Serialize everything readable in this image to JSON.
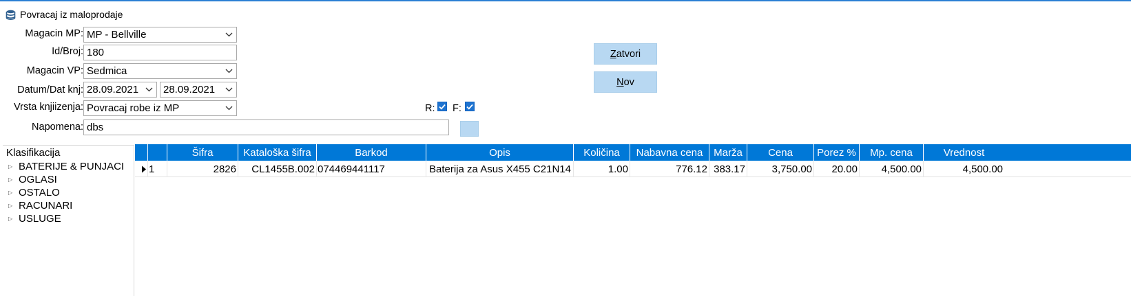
{
  "window": {
    "title": "Povracaj iz maloprodaje",
    "icon": "database-icon"
  },
  "form": {
    "magacin_mp": {
      "label": "Magacin MP:",
      "value": "MP - Bellville"
    },
    "id_broj": {
      "label": "Id/Broj:",
      "value": "180"
    },
    "magacin_vp": {
      "label": "Magacin VP:",
      "value": "Sedmica"
    },
    "datum": {
      "label": "Datum/Dat knj:",
      "date": "28.09.2021",
      "date_knj": "28.09.2021"
    },
    "vrsta": {
      "label": "Vrsta knjiizenja:",
      "value": "Povracaj robe iz MP"
    },
    "napomena": {
      "label": "Napomena:",
      "value": "dbs"
    },
    "r_label": "R:",
    "f_label": "F:",
    "r_checked": true,
    "f_checked": true
  },
  "buttons": {
    "zatvori": {
      "mnemonic": "Z",
      "rest": "atvori"
    },
    "nov": {
      "mnemonic": "N",
      "rest": "ov"
    }
  },
  "tree": {
    "header": "Klasifikacija",
    "items": [
      "BATERIJE & PUNJACI",
      "OGLASI",
      "OSTALO",
      "RACUNARI",
      "USLUGE"
    ]
  },
  "grid": {
    "columns": [
      "",
      "",
      "Šifra",
      "Kataloška šifra",
      "Barkod",
      "Opis",
      "Količina",
      "Nabavna cena",
      "Marža",
      "Cena",
      "Porez %",
      "Mp. cena",
      "Vrednost"
    ],
    "rows": [
      {
        "rb": "1",
        "sifra": "2826",
        "kataloska": "CL1455B.002",
        "barkod": "074469441117",
        "opis": "Baterija za Asus X455  C21N14",
        "kolicina": "1.00",
        "nabavna": "776.12",
        "marza": "383.17",
        "cena": "3,750.00",
        "porez": "20.00",
        "mp_cena": "4,500.00",
        "vrednost": "4,500.00"
      }
    ]
  },
  "colors": {
    "header_blue": "#0078d7",
    "button_blue": "#b8d8f2",
    "check_blue": "#1e73d0"
  }
}
